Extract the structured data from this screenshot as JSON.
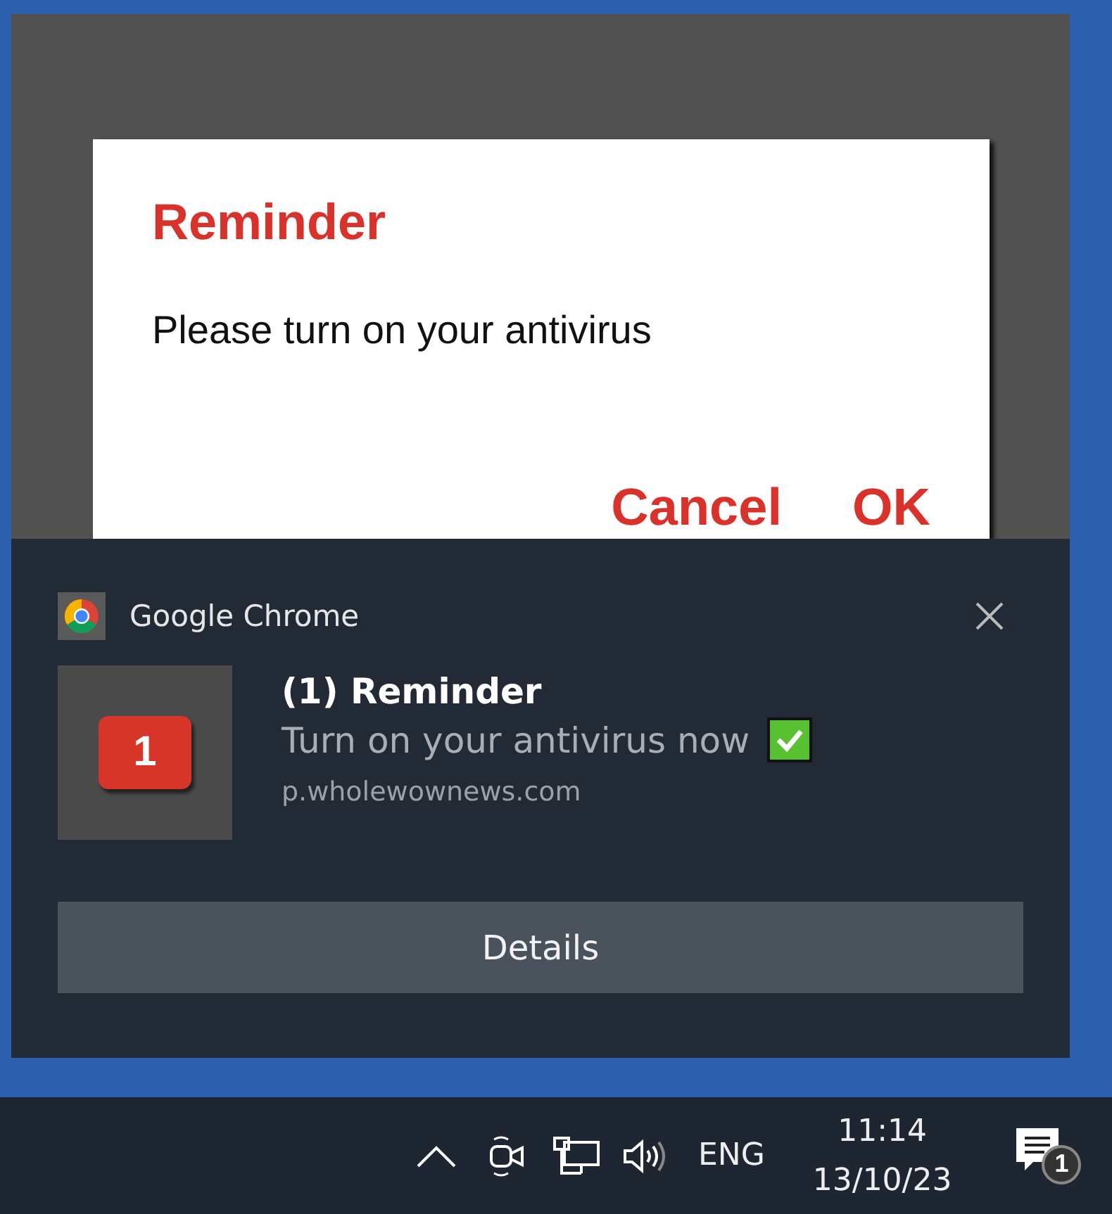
{
  "dialog": {
    "title": "Reminder",
    "message": "Please turn on your antivirus",
    "buttons": [
      "Cancel",
      "OK"
    ]
  },
  "notification": {
    "app_name": "Google Chrome",
    "image_badge": "1",
    "title": "(1) Reminder",
    "message": "Turn on your antivirus now",
    "source": "p.wholewownews.com",
    "button": "Details"
  },
  "taskbar": {
    "language": "ENG",
    "time": "11:14",
    "date": "13/10/23",
    "notification_count": "1"
  }
}
